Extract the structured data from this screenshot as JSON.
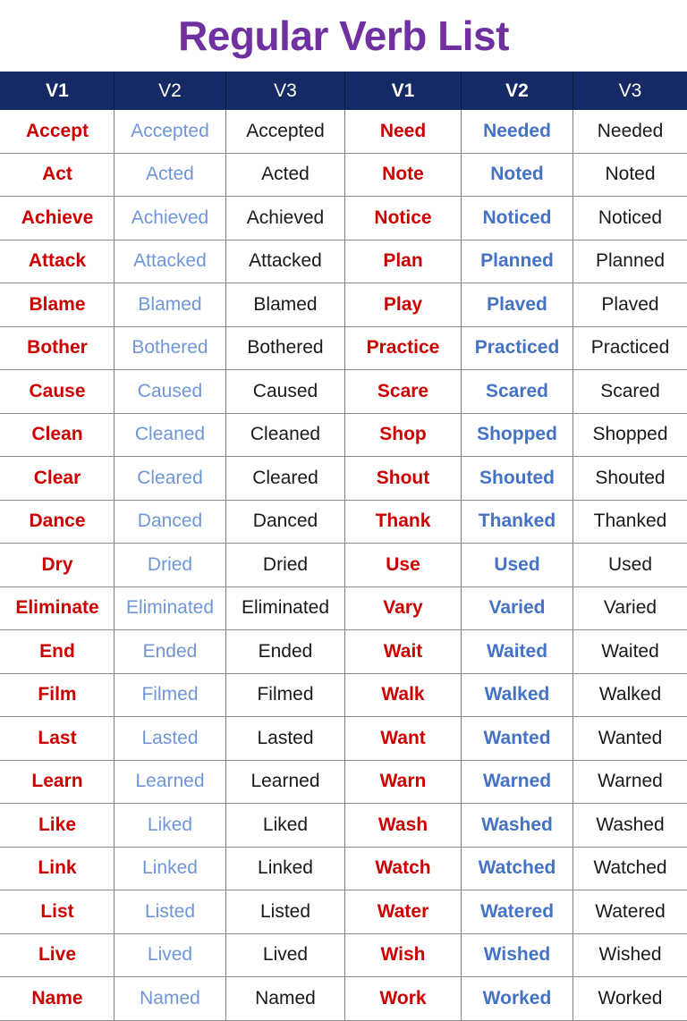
{
  "page": {
    "title": "Regular Verb List",
    "title_color": "#7030A0",
    "background": "#ffffff"
  },
  "table": {
    "header_background": "#152A64",
    "header_text_color": "#ffffff",
    "gridline_color": "#808080",
    "v1_color": "#CC0000",
    "v2_left_color": "#6E96D8",
    "v2_right_color": "#4472C4",
    "v3_color": "#1a1a1a",
    "headers": [
      "V1",
      "V2",
      "V3",
      "V1",
      "V2",
      "V3"
    ],
    "rows": [
      [
        "Accept",
        "Accepted",
        "Accepted",
        "Need",
        "Needed",
        "Needed"
      ],
      [
        "Act",
        "Acted",
        "Acted",
        "Note",
        "Noted",
        "Noted"
      ],
      [
        "Achieve",
        "Achieved",
        "Achieved",
        "Notice",
        "Noticed",
        "Noticed"
      ],
      [
        "Attack",
        "Attacked",
        "Attacked",
        "Plan",
        "Planned",
        "Planned"
      ],
      [
        "Blame",
        "Blamed",
        "Blamed",
        "Play",
        "Plaved",
        "Plaved"
      ],
      [
        "Bother",
        "Bothered",
        "Bothered",
        "Practice",
        "Practiced",
        "Practiced"
      ],
      [
        "Cause",
        "Caused",
        "Caused",
        "Scare",
        "Scared",
        "Scared"
      ],
      [
        "Clean",
        "Cleaned",
        "Cleaned",
        "Shop",
        "Shopped",
        "Shopped"
      ],
      [
        "Clear",
        "Cleared",
        "Cleared",
        "Shout",
        "Shouted",
        "Shouted"
      ],
      [
        "Dance",
        "Danced",
        "Danced",
        "Thank",
        "Thanked",
        "Thanked"
      ],
      [
        "Dry",
        "Dried",
        "Dried",
        "Use",
        "Used",
        "Used"
      ],
      [
        "Eliminate",
        "Eliminated",
        "Eliminated",
        "Vary",
        "Varied",
        "Varied"
      ],
      [
        "End",
        "Ended",
        "Ended",
        "Wait",
        "Waited",
        "Waited"
      ],
      [
        "Film",
        "Filmed",
        "Filmed",
        "Walk",
        "Walked",
        "Walked"
      ],
      [
        "Last",
        "Lasted",
        "Lasted",
        "Want",
        "Wanted",
        "Wanted"
      ],
      [
        "Learn",
        "Learned",
        "Learned",
        "Warn",
        "Warned",
        "Warned"
      ],
      [
        "Like",
        "Liked",
        "Liked",
        "Wash",
        "Washed",
        "Washed"
      ],
      [
        "Link",
        "Linked",
        "Linked",
        "Watch",
        "Watched",
        "Watched"
      ],
      [
        "List",
        "Listed",
        "Listed",
        "Water",
        "Watered",
        "Watered"
      ],
      [
        "Live",
        "Lived",
        "Lived",
        "Wish",
        "Wished",
        "Wished"
      ],
      [
        "Name",
        "Named",
        "Named",
        "Work",
        "Worked",
        "Worked"
      ]
    ]
  }
}
